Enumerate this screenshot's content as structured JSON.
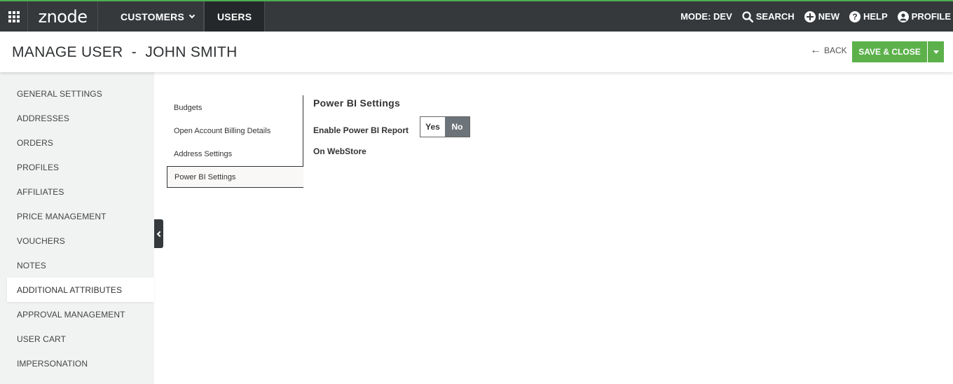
{
  "topbar": {
    "logo": "znode",
    "nav": [
      {
        "label": "CUSTOMERS"
      },
      {
        "label": "USERS"
      }
    ],
    "mode": "MODE: DEV",
    "search": "SEARCH",
    "new": "NEW",
    "help": "HELP",
    "profile": "PROFILE"
  },
  "header": {
    "title": "MANAGE USER  -  JOHN SMITH",
    "back": "BACK",
    "save_close": "SAVE & CLOSE"
  },
  "sidebar": {
    "items": [
      {
        "label": "GENERAL SETTINGS"
      },
      {
        "label": "ADDRESSES"
      },
      {
        "label": "ORDERS"
      },
      {
        "label": "PROFILES"
      },
      {
        "label": "AFFILIATES"
      },
      {
        "label": "PRICE MANAGEMENT"
      },
      {
        "label": "VOUCHERS"
      },
      {
        "label": "NOTES"
      },
      {
        "label": "ADDITIONAL ATTRIBUTES"
      },
      {
        "label": "APPROVAL MANAGEMENT"
      },
      {
        "label": "USER CART"
      },
      {
        "label": "IMPERSONATION"
      }
    ],
    "active": "ADDITIONAL ATTRIBUTES"
  },
  "subtabs": {
    "items": [
      {
        "label": "Budgets"
      },
      {
        "label": "Open Account Billing Details"
      },
      {
        "label": "Address Settings"
      },
      {
        "label": "Power BI Settings"
      }
    ],
    "active": "Power BI Settings"
  },
  "content": {
    "section_title": "Power BI Settings",
    "field_label": "Enable Power BI Report On WebStore",
    "toggle": {
      "yes": "Yes",
      "no": "No",
      "selected": "No"
    }
  },
  "colors": {
    "topbar": "#35393c",
    "accent_green": "#5cb14b",
    "sidebar_bg": "#f1f2f2",
    "toggle_selected": "#6d7479"
  }
}
